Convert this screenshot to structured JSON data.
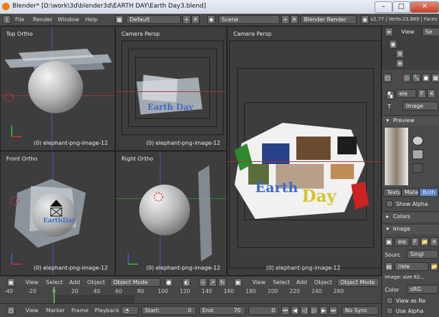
{
  "window": {
    "title": "Blender* [D:\\work\\3d\\blender3d\\EARTH DAY\\Earth Day3.blend]",
    "btn_minimize": "–",
    "btn_maximize": "□",
    "btn_close": "✕"
  },
  "info_header": {
    "menus": [
      "File",
      "Render",
      "Window",
      "Help"
    ],
    "screen_layout": "Default",
    "scene": "Scene",
    "render_engine": "Blender Render",
    "version_stats": "v2.77 | Verts:23,889 | Faces"
  },
  "viewports": {
    "top_left": {
      "label": "Top Ortho",
      "object": "(0) elephant-png-image-12"
    },
    "top_mid": {
      "label": "Camera Persp",
      "object": "(0) elephant-png-image-12",
      "overlay_text": "Earth Day"
    },
    "bottom_left": {
      "label": "Front Ortho",
      "object": "(0) elephant-png-image-12",
      "overlay_text": "EarthDay"
    },
    "bottom_mid": {
      "label": "Right Ortho",
      "object": "(0) elephant-png-image-12"
    },
    "big": {
      "label": "Camera Persp",
      "object": "(0) elephant-png-image-12",
      "overlay_text_a": "Earth",
      "overlay_text_b": "Day"
    }
  },
  "view3d_header_left": {
    "menus": [
      "View",
      "Select",
      "Add",
      "Object"
    ],
    "mode": "Object Mode"
  },
  "view3d_header_right": {
    "menus": [
      "View",
      "Select",
      "Add",
      "Object"
    ],
    "mode": "Object Mode"
  },
  "timeline": {
    "ticks": [
      "-40",
      "-20",
      "0",
      "20",
      "40",
      "60",
      "80",
      "100",
      "120",
      "140",
      "160",
      "180",
      "200",
      "220",
      "240",
      "260"
    ],
    "menus": [
      "View",
      "Marker",
      "Frame",
      "Playback"
    ],
    "start_label": "Start:",
    "start_value": "0",
    "end_label": "End:",
    "end_value": "70",
    "current_frame": "0",
    "sync": "No Sync"
  },
  "properties": {
    "outliner_view": "View",
    "outliner_search": "Se",
    "tex_name": "ele",
    "tex_users": "F",
    "type_label": "T",
    "type_value": "Image",
    "preview_header": "Preview",
    "preview_tabs": [
      "Textu",
      "Mater",
      "Both"
    ],
    "show_alpha": "Show Alpha",
    "colors_header": "Colors",
    "image_header": "Image",
    "img_name": "ele",
    "img_users": "F",
    "source_label": "Sourc",
    "source_value": "Singl",
    "filepath": "//ele",
    "image_size": "Image: size 62...",
    "color_label": "Color",
    "color_value": "sRG",
    "view_as_render": "View as Re",
    "use_alpha": "Use Alpha"
  }
}
